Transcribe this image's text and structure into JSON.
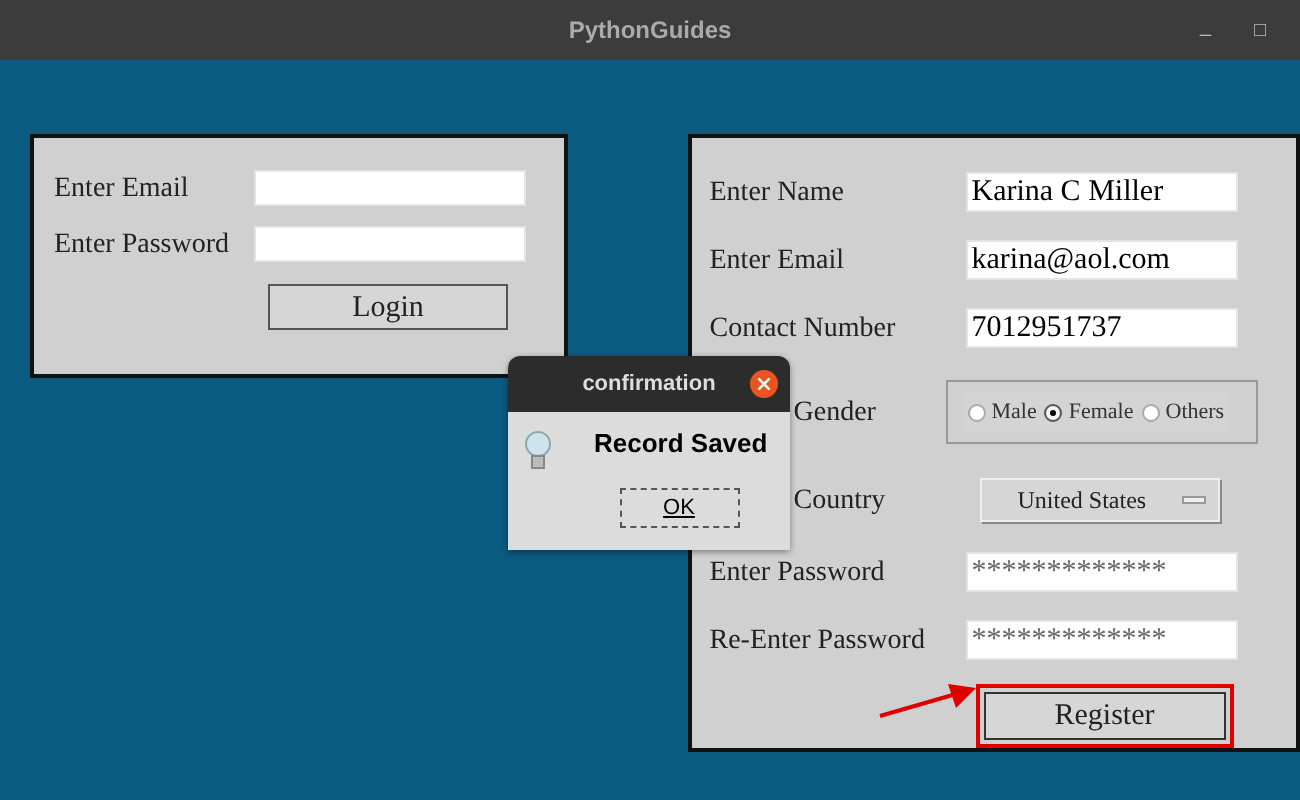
{
  "window": {
    "title": "PythonGuides",
    "controls": [
      "_",
      "□"
    ]
  },
  "login": {
    "fields": [
      {
        "label": "Enter Email"
      },
      {
        "label": "Enter Password"
      }
    ],
    "button": "Login"
  },
  "register": {
    "rows": [
      {
        "kind": "text",
        "label": "Enter Name",
        "value": "Karina C Miller"
      },
      {
        "kind": "text",
        "label": "Enter Email",
        "value": "karina@aol.com"
      },
      {
        "kind": "text",
        "label": "Contact Number",
        "value": "7012951737"
      },
      {
        "kind": "radio",
        "label": "Gender",
        "options": [
          {
            "label": "Male",
            "selected": false
          },
          {
            "label": "Female",
            "selected": true
          },
          {
            "label": "Others",
            "selected": false
          }
        ]
      },
      {
        "kind": "dropdown",
        "label": "Country",
        "value": "United States"
      },
      {
        "kind": "password",
        "label": "Enter Password",
        "value": "*************"
      },
      {
        "kind": "password",
        "label": "Re-Enter Password",
        "value": "*************"
      }
    ],
    "button": "Register",
    "highlighted": true
  },
  "dialog": {
    "title": "confirmation",
    "message": "Record Saved",
    "button": "OK"
  }
}
